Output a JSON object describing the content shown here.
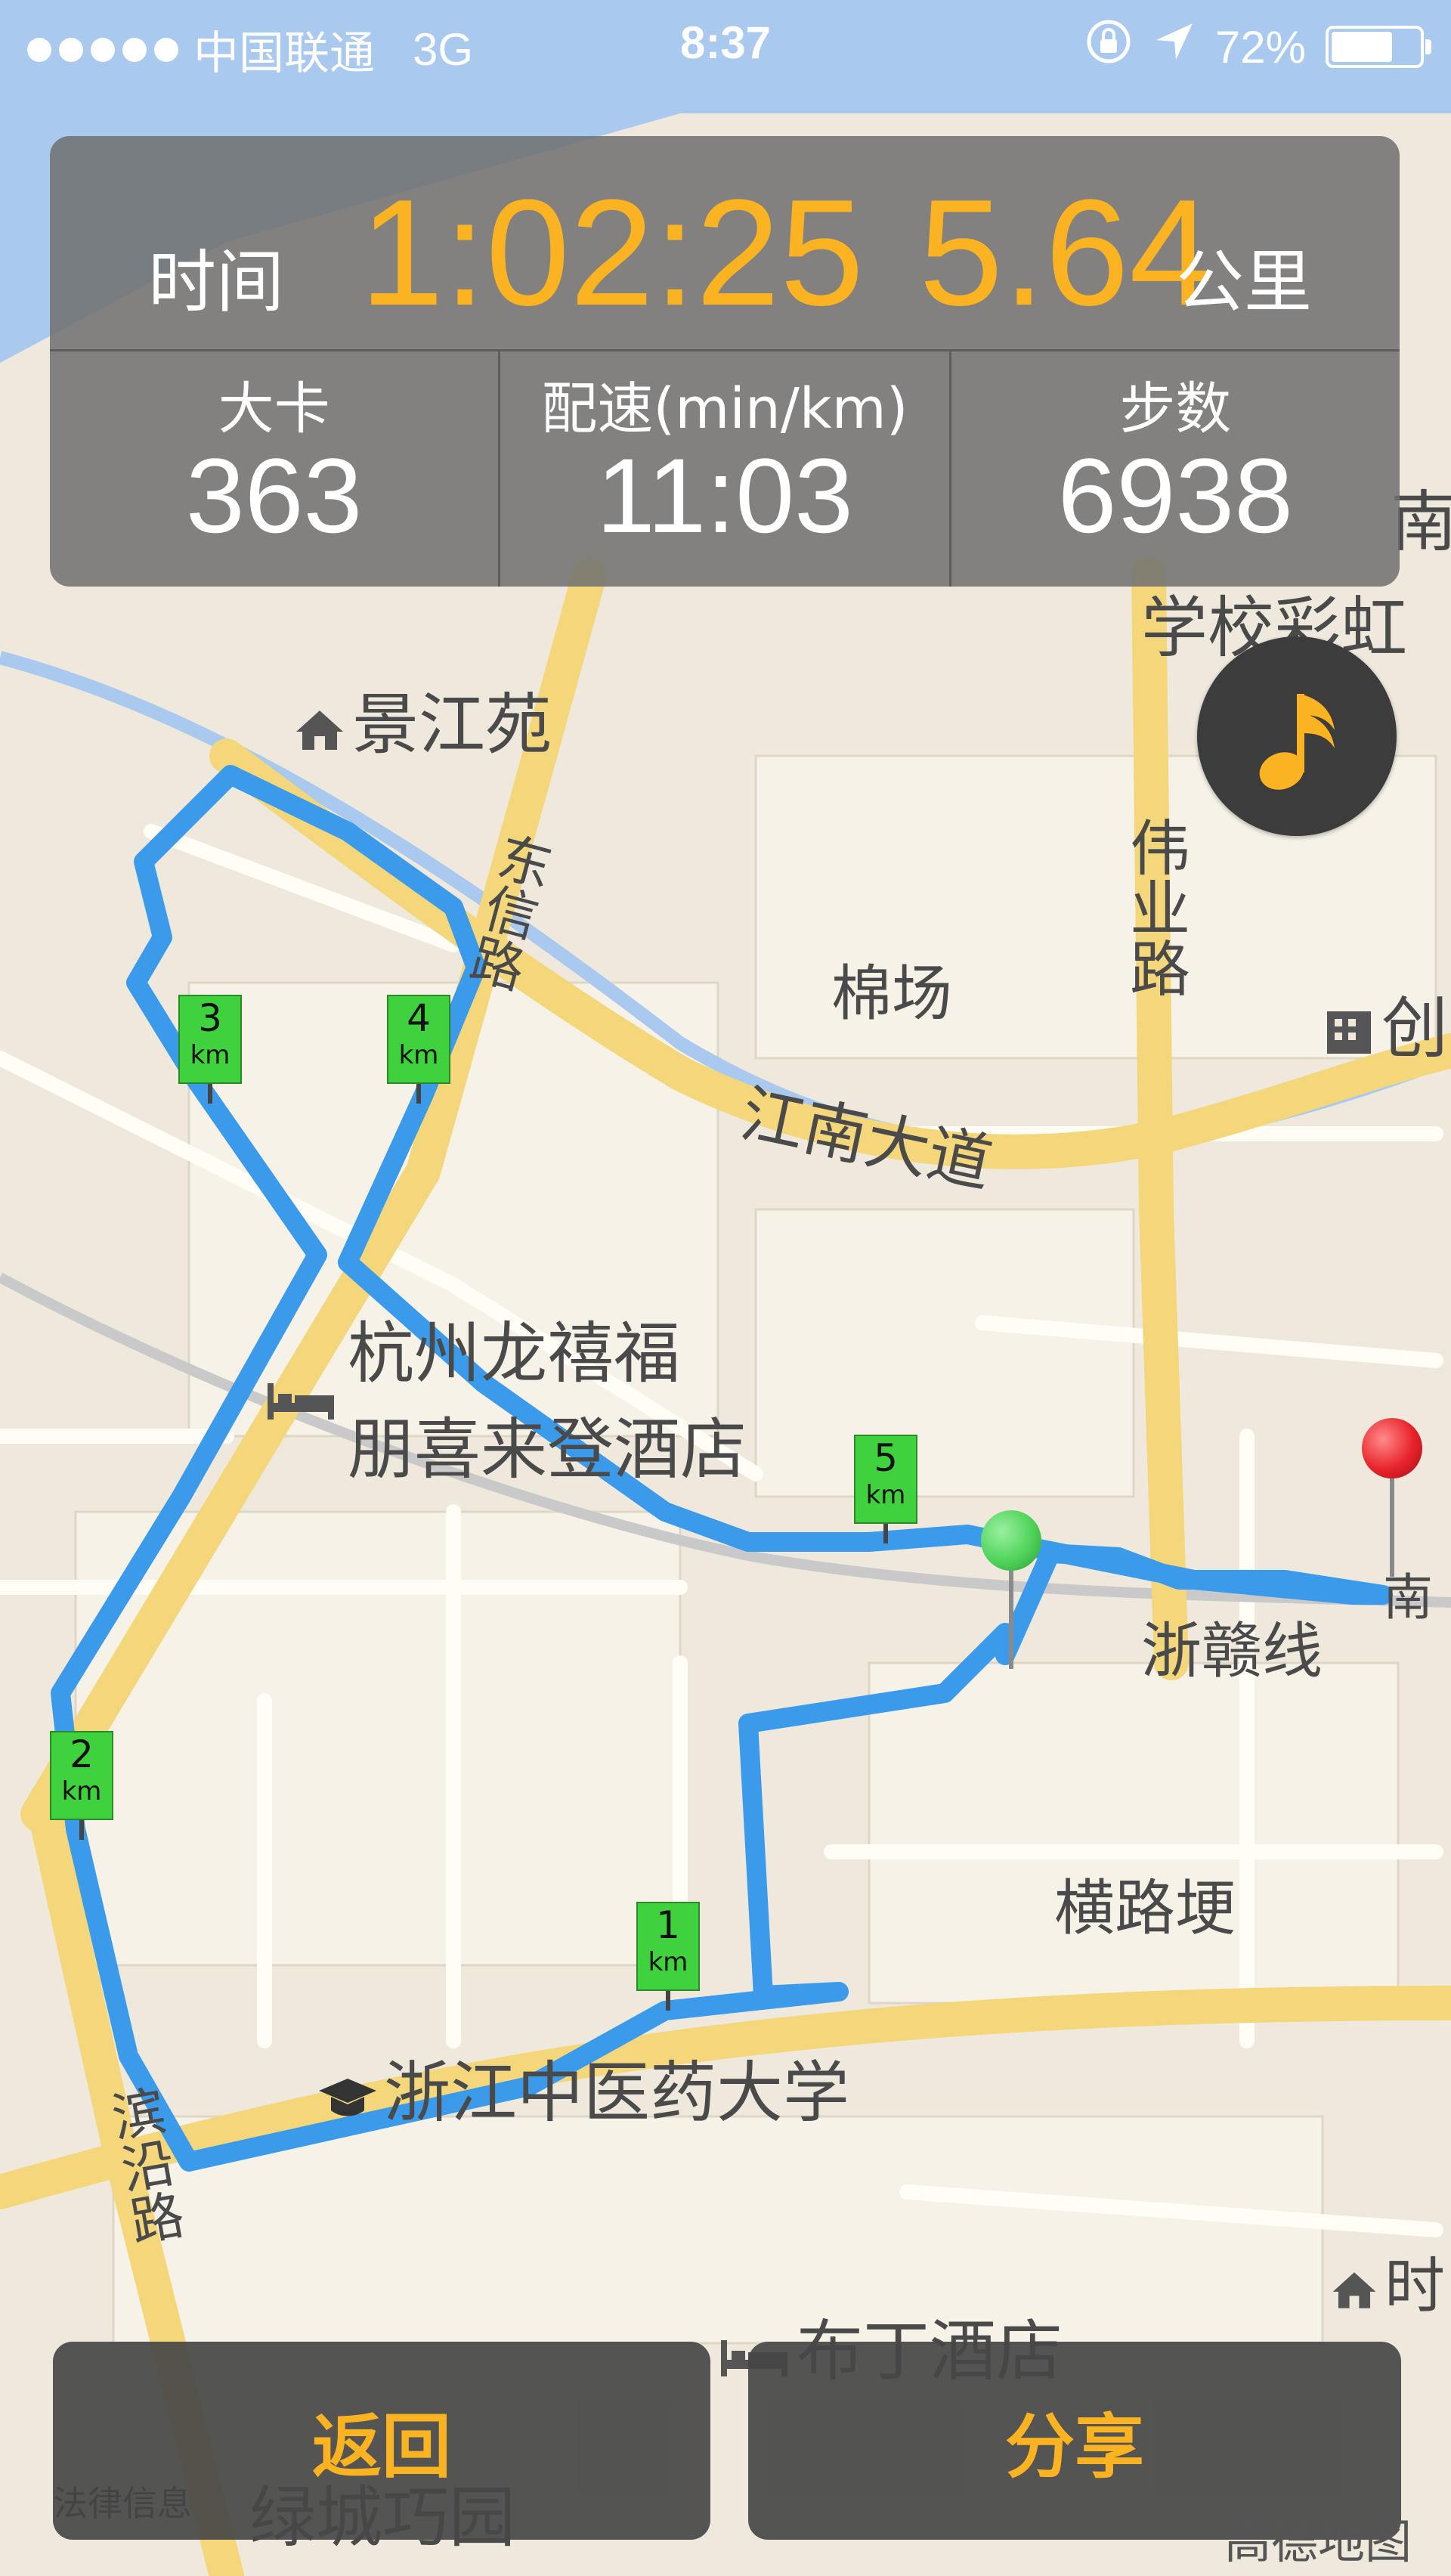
{
  "status_bar": {
    "carrier": "中国联通",
    "network": "3G",
    "time": "8:37",
    "battery": "72%",
    "battery_fraction": 0.72
  },
  "stats": {
    "time_label": "时间",
    "time_value": "1:02:25",
    "distance_value": "5.64",
    "distance_unit": "公里",
    "calories_label": "大卡",
    "calories_value": "363",
    "pace_label": "配速(min/km)",
    "pace_value": "11:03",
    "steps_label": "步数",
    "steps_value": "6938"
  },
  "map": {
    "labels": {
      "jingjiangyuan": "景江苑",
      "dongxin_road": "东信路",
      "mianchang": "棉场",
      "weiye_road": "伟业路",
      "jiangnan_avenue": "江南大道",
      "chuang": "创",
      "xuexiao": "学校彩虹",
      "nan_top": "南",
      "hotel_line1": "杭州龙禧福",
      "hotel_line2": "朋喜来登酒店",
      "zhegan_line": "浙赣线",
      "nan_right": "南",
      "henglugeng": "横路埂",
      "university": "浙江中医药大学",
      "binyan_road": "滨沿路",
      "shi": "时",
      "buding_hotel": "布丁酒店",
      "lvcheng": "绿城巧园"
    },
    "km_markers": [
      {
        "num": "1",
        "unit": "km"
      },
      {
        "num": "2",
        "unit": "km"
      },
      {
        "num": "3",
        "unit": "km"
      },
      {
        "num": "4",
        "unit": "km"
      },
      {
        "num": "5",
        "unit": "km"
      }
    ],
    "legal_text": "法律信息",
    "provider": "高德地图",
    "colors": {
      "route": "#3b9bea",
      "start_pin": "#4fd35a",
      "end_pin": "#e8232a",
      "marker": "#3fd23c",
      "accent": "#fbb321"
    }
  },
  "buttons": {
    "back": "返回",
    "share": "分享"
  }
}
